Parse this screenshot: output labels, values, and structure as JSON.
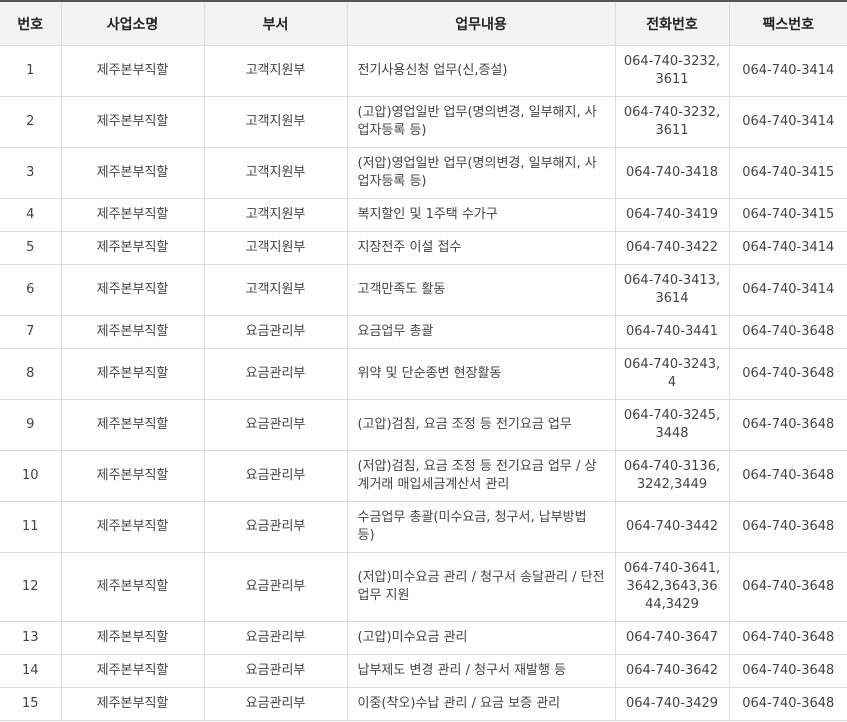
{
  "headers": {
    "no": "번호",
    "office": "사업소명",
    "dept": "부서",
    "duty": "업무내용",
    "phone": "전화번호",
    "fax": "팩스번호"
  },
  "rows": [
    {
      "no": "1",
      "office": "제주본부직할",
      "dept": "고객지원부",
      "duty": "전기사용신청 업무(신,증설)",
      "phone": "064-740-3232, 3611",
      "fax": "064-740-3414"
    },
    {
      "no": "2",
      "office": "제주본부직할",
      "dept": "고객지원부",
      "duty": "(고압)영업일반 업무(명의변경, 일부해지, 사업자등록 등)",
      "phone": "064-740-3232, 3611",
      "fax": "064-740-3414"
    },
    {
      "no": "3",
      "office": "제주본부직할",
      "dept": "고객지원부",
      "duty": "(저압)영업일반 업무(명의변경, 일부해지, 사업자등록 등)",
      "phone": "064-740-3418",
      "fax": "064-740-3415"
    },
    {
      "no": "4",
      "office": "제주본부직할",
      "dept": "고객지원부",
      "duty": "복지할인 및 1주택 수가구",
      "phone": "064-740-3419",
      "fax": "064-740-3415"
    },
    {
      "no": "5",
      "office": "제주본부직할",
      "dept": "고객지원부",
      "duty": "지장전주 이설 접수",
      "phone": "064-740-3422",
      "fax": "064-740-3414"
    },
    {
      "no": "6",
      "office": "제주본부직할",
      "dept": "고객지원부",
      "duty": "고객만족도 활동",
      "phone": "064-740-3413, 3614",
      "fax": "064-740-3414"
    },
    {
      "no": "7",
      "office": "제주본부직할",
      "dept": "요금관리부",
      "duty": "요금업무 총괄",
      "phone": "064-740-3441",
      "fax": "064-740-3648"
    },
    {
      "no": "8",
      "office": "제주본부직할",
      "dept": "요금관리부",
      "duty": "위약 및 단순종변 현장활동",
      "phone": "064-740-3243, 4",
      "fax": "064-740-3648"
    },
    {
      "no": "9",
      "office": "제주본부직할",
      "dept": "요금관리부",
      "duty": "(고압)검침, 요금 조정 등 전기요금 업무",
      "phone": "064-740-3245, 3448",
      "fax": "064-740-3648"
    },
    {
      "no": "10",
      "office": "제주본부직할",
      "dept": "요금관리부",
      "duty": "(저압)검침, 요금 조정 등 전기요금 업무 / 상계거래 매입세금계산서 관리",
      "phone": "064-740-3136, 3242,3449",
      "fax": "064-740-3648"
    },
    {
      "no": "11",
      "office": "제주본부직할",
      "dept": "요금관리부",
      "duty": "수금업무 총괄(미수요금, 청구서, 납부방법 등)",
      "phone": "064-740-3442",
      "fax": "064-740-3648"
    },
    {
      "no": "12",
      "office": "제주본부직할",
      "dept": "요금관리부",
      "duty": "(저압)미수요금 관리 / 청구서 송달관리 / 단전업무 지원",
      "phone": "064-740-3641, 3642,3643,3644,3429",
      "fax": "064-740-3648"
    },
    {
      "no": "13",
      "office": "제주본부직할",
      "dept": "요금관리부",
      "duty": "(고압)미수요금 관리",
      "phone": "064-740-3647",
      "fax": "064-740-3648"
    },
    {
      "no": "14",
      "office": "제주본부직할",
      "dept": "요금관리부",
      "duty": "납부제도 변경 관리 / 청구서 재발행 등",
      "phone": "064-740-3642",
      "fax": "064-740-3648"
    },
    {
      "no": "15",
      "office": "제주본부직할",
      "dept": "요금관리부",
      "duty": "이중(착오)수납 관리 / 요금 보증 관리",
      "phone": "064-740-3429",
      "fax": "064-740-3648"
    }
  ]
}
